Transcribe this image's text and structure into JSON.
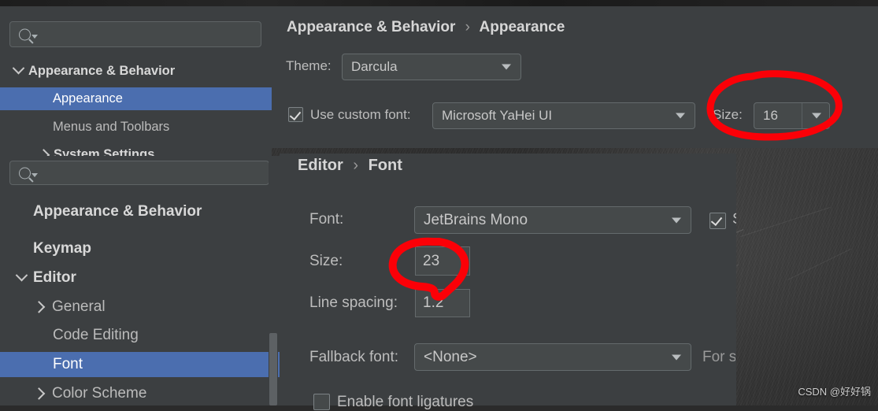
{
  "window_top": {
    "title": "Appearance & Behavior > Appearance",
    "search": {
      "placeholder": "",
      "value": "",
      "icon": "search-icon"
    },
    "sidebar": {
      "items": [
        {
          "label": "Appearance & Behavior",
          "expander": "chevron-down-icon",
          "bold": true,
          "selected": false,
          "indent": 0
        },
        {
          "label": "Appearance",
          "expander": "",
          "bold": false,
          "selected": true,
          "indent": 1
        },
        {
          "label": "Menus and Toolbars",
          "expander": "",
          "bold": false,
          "selected": false,
          "indent": 1
        },
        {
          "label": "System Settings",
          "expander": "chevron-right-icon",
          "bold": false,
          "selected": false,
          "indent": 1
        }
      ]
    },
    "breadcrumb": {
      "root": "Appearance & Behavior",
      "separator": "›",
      "leaf": "Appearance"
    },
    "theme": {
      "label": "Theme:",
      "value": "Darcula",
      "icon": "chevron-down-icon"
    },
    "custom_font": {
      "checkbox_label": "Use custom font:",
      "checked": true,
      "value": "Microsoft YaHei UI",
      "icon": "chevron-down-icon"
    },
    "size": {
      "label": "Size:",
      "value": "16",
      "icon": "chevron-down-icon"
    }
  },
  "window_bottom": {
    "title": "Editor > Font",
    "search": {
      "placeholder": "",
      "value": "",
      "icon": "search-icon"
    },
    "sidebar": {
      "items": [
        {
          "label": "Appearance & Behavior",
          "expander": "",
          "bold": true,
          "selected": false,
          "indent": 0
        },
        {
          "label": "Keymap",
          "expander": "",
          "bold": true,
          "selected": false,
          "indent": 0
        },
        {
          "label": "Editor",
          "expander": "chevron-down-icon",
          "bold": true,
          "selected": false,
          "indent": 0
        },
        {
          "label": "General",
          "expander": "chevron-right-icon",
          "bold": false,
          "selected": false,
          "indent": 1
        },
        {
          "label": "Code Editing",
          "expander": "",
          "bold": false,
          "selected": false,
          "indent": 1
        },
        {
          "label": "Font",
          "expander": "",
          "bold": false,
          "selected": true,
          "indent": 1
        },
        {
          "label": "Color Scheme",
          "expander": "chevron-right-icon",
          "bold": false,
          "selected": false,
          "indent": 1
        }
      ]
    },
    "breadcrumb": {
      "root": "Editor",
      "separator": "›",
      "leaf": "Font"
    },
    "font": {
      "label": "Font:",
      "value": "JetBrains Mono",
      "icon": "chevron-down-icon"
    },
    "size": {
      "label": "Size:",
      "value": "23"
    },
    "line_spacing": {
      "label": "Line spacing:",
      "value": "1.2"
    },
    "fallback": {
      "label": "Fallback font:",
      "value": "<None>",
      "icon": "chevron-down-icon"
    },
    "fallback_hint": "For s",
    "show_only_monospaced": {
      "checked": true,
      "label_clipped": "S"
    },
    "ligatures": {
      "label": "Enable font ligatures",
      "checked": false
    }
  },
  "annotations": {
    "accent_color": "#fb0007",
    "circle_top_target": "Size: 16",
    "circle_bottom_target": "23"
  },
  "watermark": "CSDN @好好锅",
  "colors": {
    "panel_bg": "#3c3f41",
    "field_bg": "#45494a",
    "selection_blue": "#4b6eaf",
    "text": "#bbbbbb",
    "text_bright": "#d8d8d8"
  }
}
